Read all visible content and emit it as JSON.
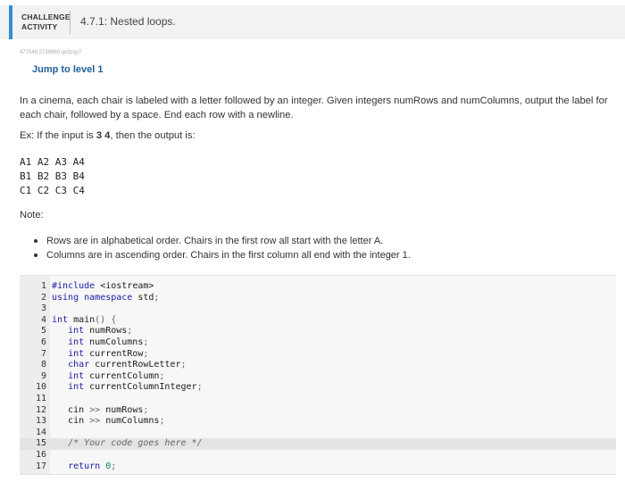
{
  "header": {
    "label_line1": "CHALLENGE",
    "label_line2": "ACTIVITY",
    "title": "4.7.1: Nested loops."
  },
  "activity_id": "477546.2739980.qx3zqy7",
  "jump_link": "Jump to level 1",
  "description": "In a cinema, each chair is labeled with a letter followed by an integer. Given integers numRows and numColumns, output the label for each chair, followed by a space. End each row with a newline.",
  "example": {
    "prefix": "Ex: If the input is ",
    "input": "3  4",
    "suffix": ", then the output is:"
  },
  "output_lines": [
    "A1 A2 A3 A4",
    "B1 B2 B3 B4",
    "C1 C2 C3 C4"
  ],
  "note_label": "Note:",
  "notes": [
    "Rows are in alphabetical order. Chairs in the first row all start with the letter A.",
    "Columns are in ascending order. Chairs in the first column all end with the integer 1."
  ],
  "editor": {
    "highlighted_line": 15,
    "lines": [
      {
        "n": "1",
        "text": "#include <iostream>"
      },
      {
        "n": "2",
        "text": "using namespace std;"
      },
      {
        "n": "3",
        "text": ""
      },
      {
        "n": "4",
        "text": "int main() {"
      },
      {
        "n": "5",
        "text": "   int numRows;"
      },
      {
        "n": "6",
        "text": "   int numColumns;"
      },
      {
        "n": "7",
        "text": "   int currentRow;"
      },
      {
        "n": "8",
        "text": "   char currentRowLetter;"
      },
      {
        "n": "9",
        "text": "   int currentColumn;"
      },
      {
        "n": "10",
        "text": "   int currentColumnInteger;"
      },
      {
        "n": "11",
        "text": ""
      },
      {
        "n": "12",
        "text": "   cin >> numRows;"
      },
      {
        "n": "13",
        "text": "   cin >> numColumns;"
      },
      {
        "n": "14",
        "text": ""
      },
      {
        "n": "15",
        "text": "   /* Your code goes here */"
      },
      {
        "n": "16",
        "text": ""
      },
      {
        "n": "17",
        "text": "   return 0;"
      }
    ]
  },
  "colors": {
    "accent": "#2f8fd0",
    "link": "#1f5f9e",
    "keyword": "#1a1aa6"
  }
}
